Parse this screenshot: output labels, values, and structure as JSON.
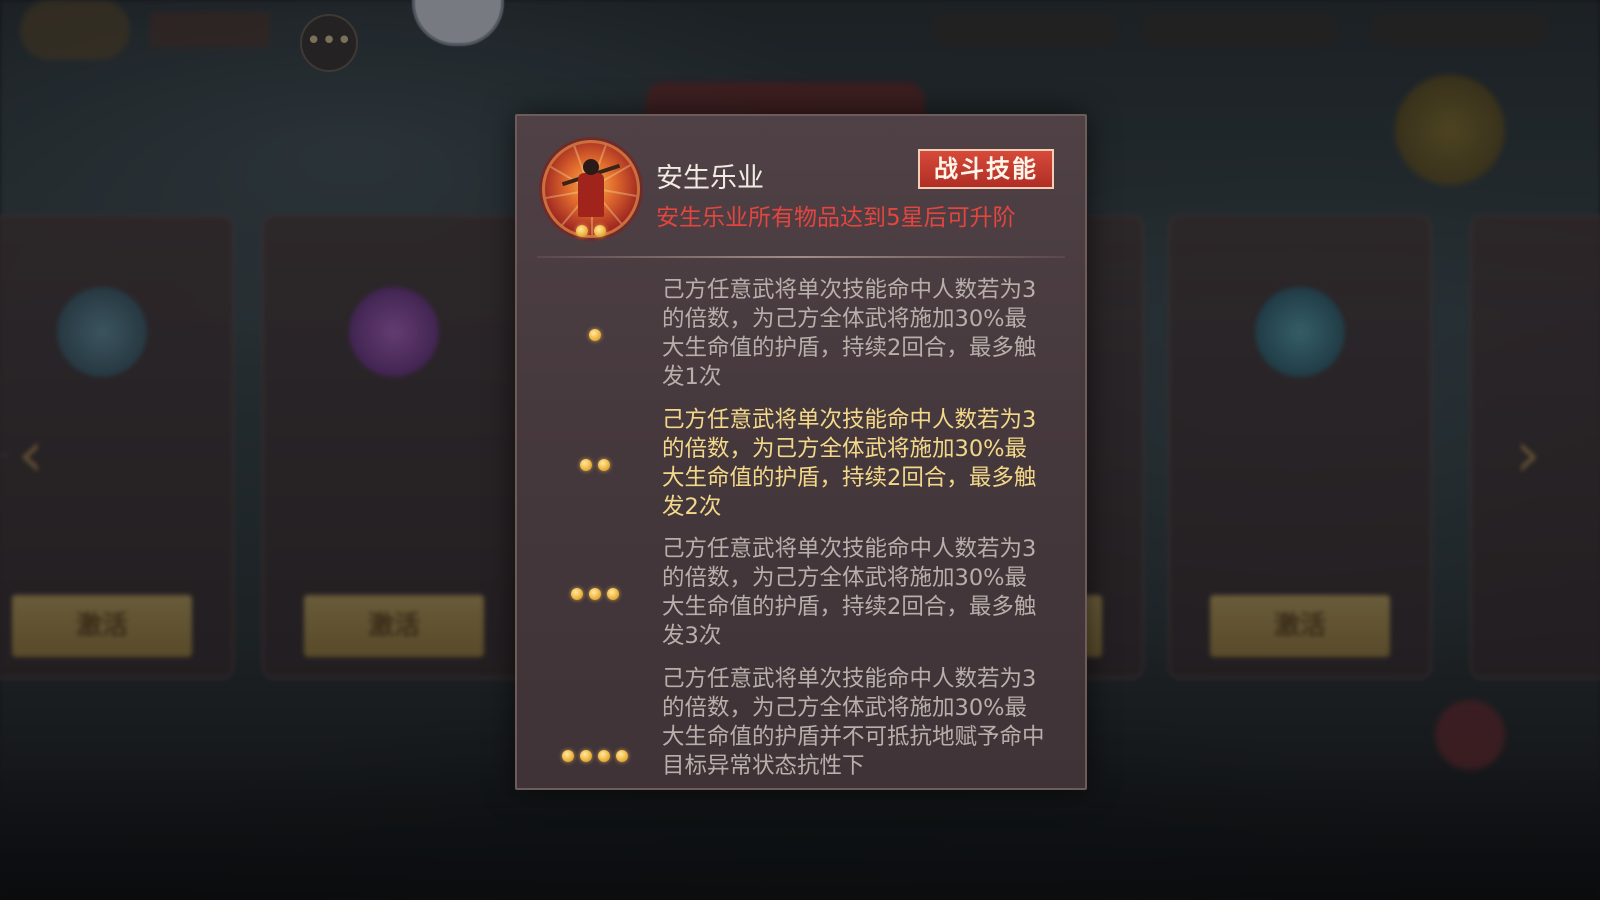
{
  "modal": {
    "skill_name": "安生乐业",
    "skill_type_tag": "战斗技能",
    "upgrade_note": "安生乐业所有物品达到5星后可升阶",
    "icon_star_count": 2,
    "tiers": [
      {
        "stars": 1,
        "active": false,
        "text": "己方任意武将单次技能命中人数若为3的倍数，为己方全体武将施加30%最大生命值的护盾，持续2回合，最多触发1次"
      },
      {
        "stars": 2,
        "active": true,
        "text": "己方任意武将单次技能命中人数若为3的倍数，为己方全体武将施加30%最大生命值的护盾，持续2回合，最多触发2次"
      },
      {
        "stars": 3,
        "active": false,
        "text": "己方任意武将单次技能命中人数若为3的倍数，为己方全体武将施加30%最大生命值的护盾，持续2回合，最多触发3次"
      },
      {
        "stars": 4,
        "active": false,
        "text": "己方任意武将单次技能命中人数若为3的倍数，为己方全体武将施加30%最大生命值的护盾并不可抵抗地赋予命中目标异常状态抗性下"
      }
    ],
    "colors": {
      "active_text": "#f3d88a",
      "inactive_text": "#b8afab",
      "warning": "#e3453f",
      "tag_bg": "#c23a2f"
    }
  },
  "background": {
    "card_button_label": "激活",
    "chat_icon": "chat-bubble-icon"
  }
}
